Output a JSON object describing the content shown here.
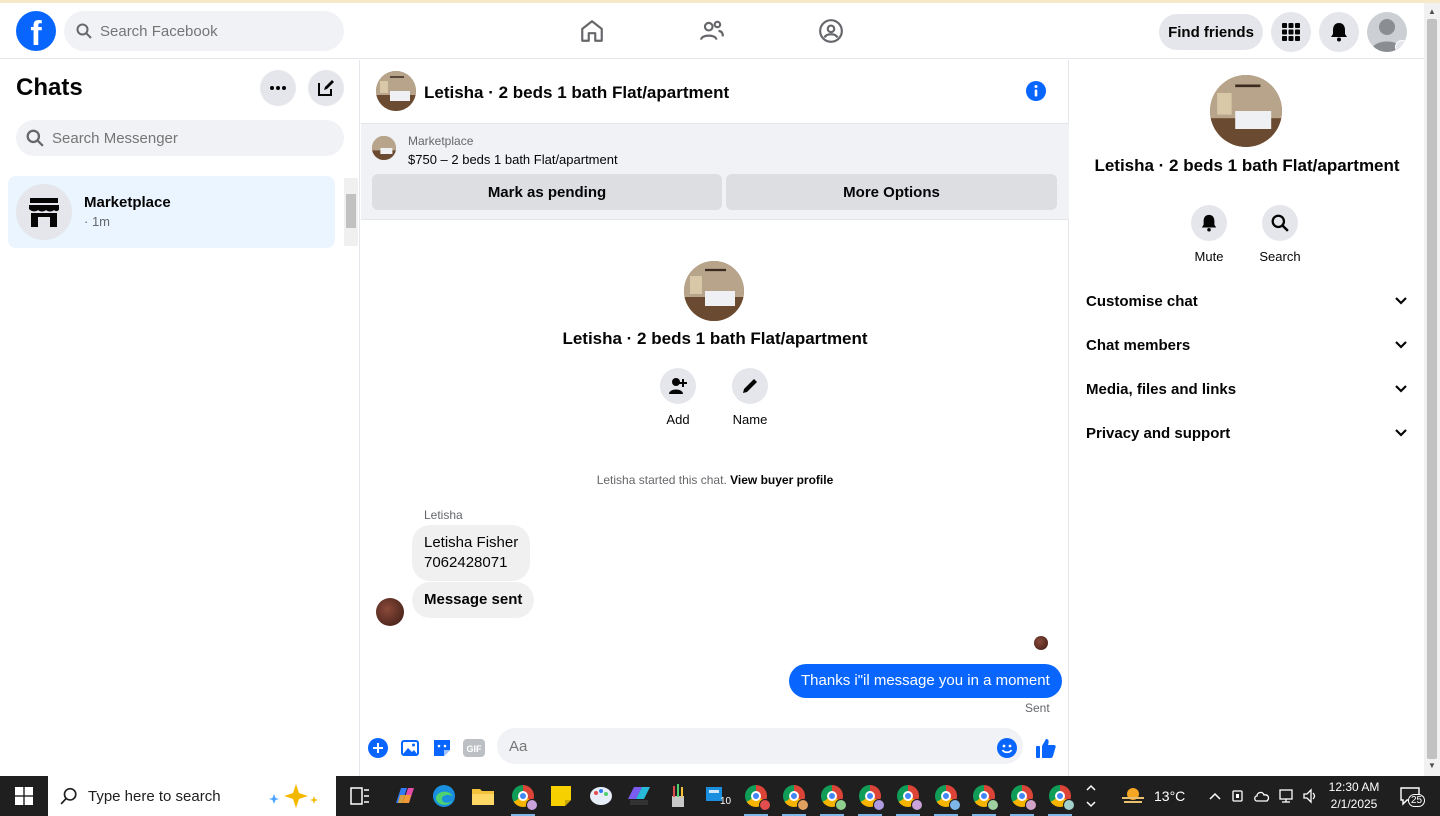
{
  "topnav": {
    "logo": "f",
    "search_placeholder": "Search Facebook",
    "find_friends": "Find friends"
  },
  "chats": {
    "title": "Chats",
    "search_placeholder": "Search Messenger",
    "items": [
      {
        "name": "Marketplace",
        "time": "· 1m"
      }
    ]
  },
  "conversation": {
    "title": "Letisha · 2 beds 1 bath Flat/apartment",
    "marketplace": {
      "label": "Marketplace",
      "listing": "$750 – 2 beds 1 bath Flat/apartment",
      "mark_pending": "Mark as pending",
      "more_options": "More Options"
    },
    "intro": {
      "name": "Letisha · 2 beds 1 bath Flat/apartment",
      "add": "Add",
      "name_action": "Name"
    },
    "started_text": "Letisha started this chat.",
    "view_profile": "View buyer profile",
    "sender": "Letisha",
    "messages_in": [
      "Letisha Fisher",
      "7062428071",
      "Message sent"
    ],
    "message_out": "Thanks i\"il message you in a moment",
    "sent_status": "Sent",
    "composer_placeholder": "Aa",
    "composer_gif": "GIF"
  },
  "info_panel": {
    "name": "Letisha · 2 beds 1 bath Flat/apartment",
    "mute": "Mute",
    "search": "Search",
    "sections": [
      "Customise chat",
      "Chat members",
      "Media, files and links",
      "Privacy and support"
    ]
  },
  "taskbar": {
    "search_placeholder": "Type here to search",
    "temperature": "13°C",
    "time": "12:30 AM",
    "date": "2/1/2025",
    "notifications": "25",
    "app_badge": "10"
  },
  "colors": {
    "brand": "#0866ff",
    "selected_chat": "#ebf5ff",
    "bubble_in": "#f0f0f0"
  }
}
